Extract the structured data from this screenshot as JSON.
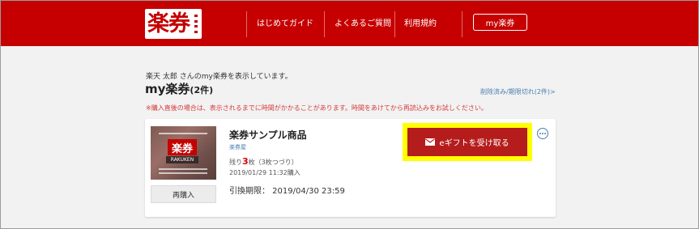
{
  "header": {
    "logo": "楽券",
    "nav": [
      "はじめてガイド",
      "よくあるご質問",
      "利用規約"
    ],
    "my_button": "my楽券"
  },
  "main": {
    "greeting": "楽天 太郎 さんのmy楽券を表示しています。",
    "title": "my楽券",
    "title_count": "(2件)",
    "expired_link": "削除済み/期限切れ(2件)>",
    "notice": "※購入直後の場合は、表示されるまでに時間がかかることがあります。時間をあけてから再読込みをお試しください。"
  },
  "card": {
    "thumb_logo": "楽券",
    "thumb_sub": "RAKUKEN",
    "rebuy_label": "再購入",
    "product_name": "楽券サンプル商品",
    "shop_name": "楽券屋",
    "remaining_prefix": "残り",
    "remaining_count": "3",
    "remaining_suffix": "枚（3枚つづり）",
    "purchase_date": "2019/01/29 11:32購入",
    "deadline": "引換期限： 2019/04/30 23:59",
    "receive_label": "eギフトを受け取る"
  },
  "colors": {
    "brand_red": "#c60000",
    "button_red": "#b51c1c",
    "highlight": "#ffff00",
    "link_blue": "#4a7fb0"
  },
  "icons": {
    "receive_button": "mail-icon",
    "more": "more-options-icon"
  }
}
